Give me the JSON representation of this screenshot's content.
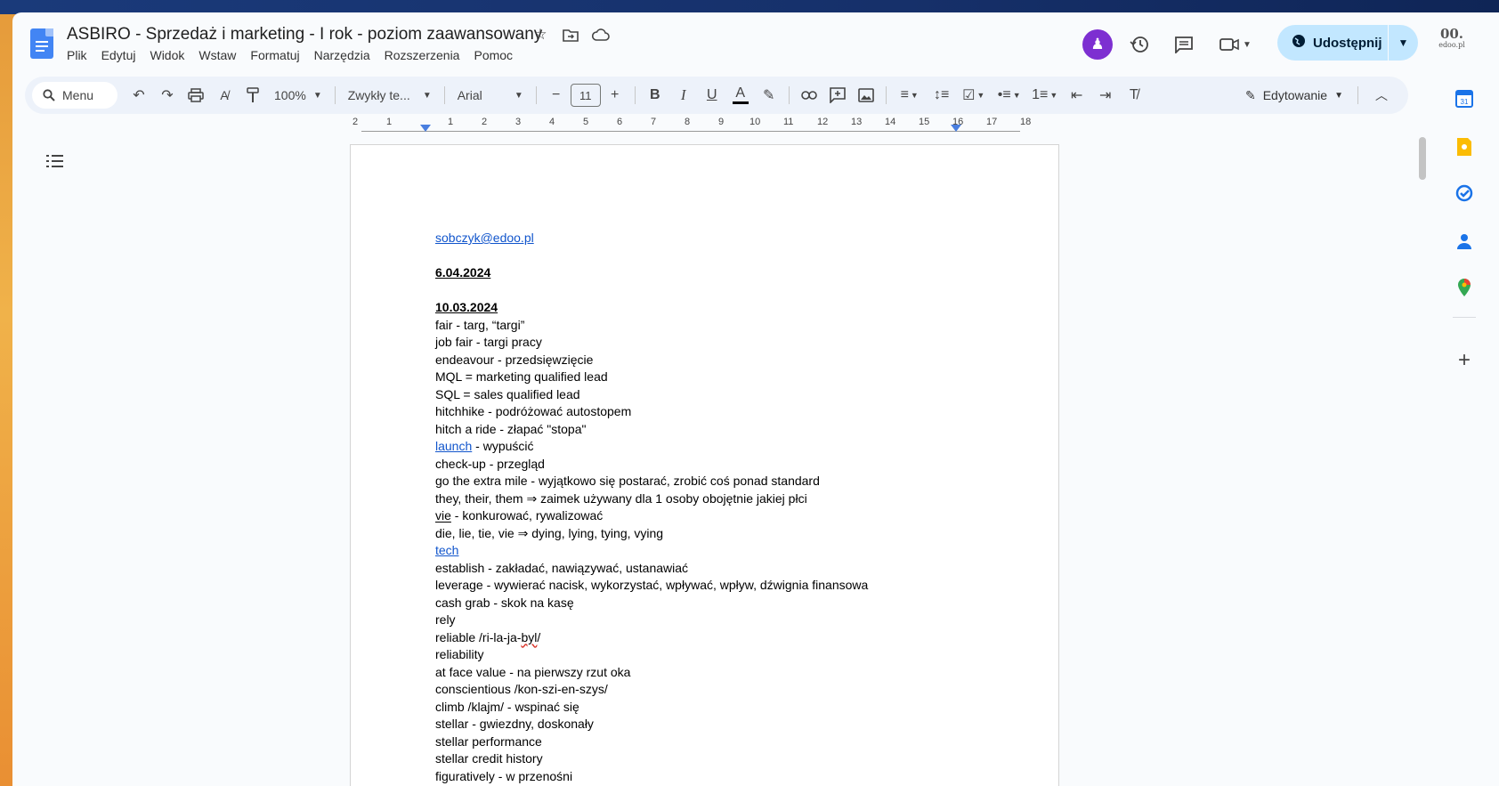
{
  "document": {
    "title": "ASBIRO - Sprzedaż i marketing - I rok - poziom zaawansowany",
    "menus": [
      "Plik",
      "Edytuj",
      "Widok",
      "Wstaw",
      "Formatuj",
      "Narzędzia",
      "Rozszerzenia",
      "Pomoc"
    ]
  },
  "header": {
    "share_label": "Udostępnij",
    "logo_text": "00.\nedoo.pl"
  },
  "toolbar": {
    "search_label": "Menu",
    "zoom": "100%",
    "style": "Zwykły te...",
    "font": "Arial",
    "font_size": "11",
    "mode": "Edytowanie",
    "bold": "B",
    "italic": "I",
    "underline": "U",
    "text_color": "A"
  },
  "ruler": {
    "labels": [
      "2",
      "1",
      "1",
      "2",
      "3",
      "4",
      "5",
      "6",
      "7",
      "8",
      "9",
      "10",
      "11",
      "12",
      "13",
      "14",
      "15",
      "16",
      "17",
      "18"
    ]
  },
  "content": {
    "email": "sobczyk@edoo.pl",
    "date1": "6.04.2024",
    "date2": "10.03.2024",
    "lines": [
      "fair - targ, “targi”",
      "job fair - targi pracy",
      "endeavour - przedsięwzięcie",
      "MQL = marketing qualified lead",
      "SQL = sales qualified lead",
      "hitchhike - podróżować autostopem",
      "hitch a ride - złapać \"stopa\""
    ],
    "launch_word": "launch",
    "launch_rest": " - wypuścić",
    "lines2": [
      "check-up - przegląd",
      "go the extra mile - wyjątkowo się postarać, zrobić coś ponad standard",
      "they, their, them ⇒ zaimek używany dla 1 osoby obojętnie jakiej płci"
    ],
    "vie_word": "vie",
    "vie_rest": " - konkurować, rywalizować",
    "die_line": "die, lie, tie, vie ⇒ dying, lying, tying, vying",
    "tech_word": "tech",
    "lines3": [
      "establish - zakładać, nawiązywać, ustanawiać",
      "leverage - wywierać nacisk, wykorzystać, wpływać, wpływ, dźwignia finansowa",
      "cash grab - skok na kasę",
      "rely"
    ],
    "reliable_pre": "reliable /ri-la-ja-",
    "reliable_squig": "byl",
    "reliable_post": "/",
    "lines4": [
      "reliability",
      "at face value - na pierwszy rzut oka",
      "conscientious /kon-szi-en-szys/",
      "climb /klajm/ - wspinać się",
      "stellar - gwiezdny, doskonały",
      "stellar performance",
      "stellar credit history",
      "figuratively - w przenośni"
    ]
  },
  "colors": {
    "share_bg": "#c2e7ff",
    "toolbar_bg": "#edf2fa",
    "link": "#1155cc",
    "avatar": "#7d2fd1"
  }
}
